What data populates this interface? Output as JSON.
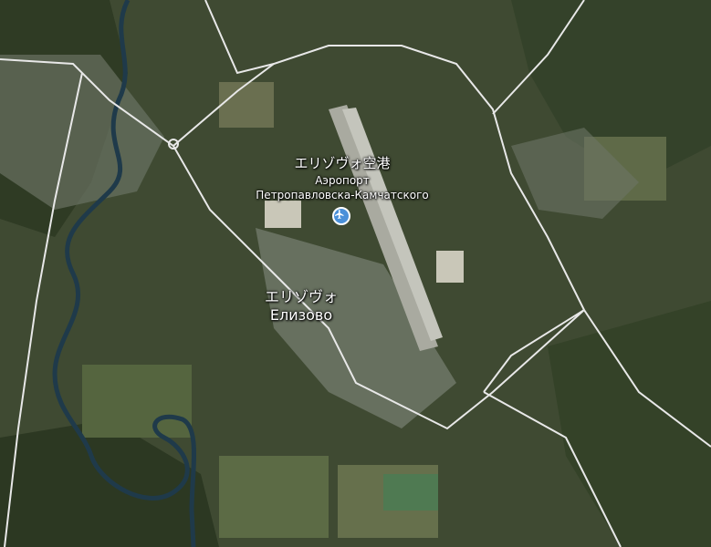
{
  "map": {
    "airport": {
      "name_ja": "エリゾヴォ空港",
      "name_ru_line1": "Аэропорт",
      "name_ru_line2": "Петропавловска-Камчатского",
      "icon": "airplane-icon"
    },
    "city": {
      "name_ja": "エリゾヴォ",
      "name_ru": "Елизово"
    },
    "colors": {
      "terrain": "#3f4a32",
      "forest": "#2f3b24",
      "field": "#5c6b45",
      "urban": "#7a8270",
      "river": "#1f3a4a",
      "road": "#e8e8e8",
      "runway": "#bdbdb4",
      "pin": "#4a90d9"
    }
  }
}
